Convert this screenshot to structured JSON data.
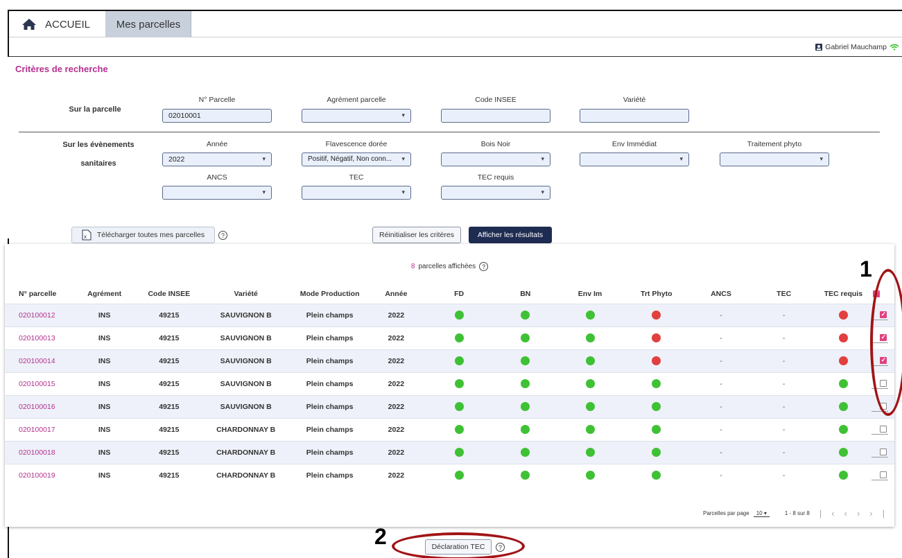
{
  "tabs": {
    "home_label": "ACCUEIL",
    "parcelles_label": "Mes parcelles"
  },
  "user": {
    "name": "Gabriel Mauchamp"
  },
  "criteria": {
    "title": "Critères de recherche",
    "parcel_row_label": "Sur la parcelle",
    "events_row_label_1": "Sur les évènements",
    "events_row_label_2": "sanitaires",
    "fields": {
      "num_parcelle": {
        "label": "N° Parcelle",
        "value": "02010001"
      },
      "agrement": {
        "label": "Agrément parcelle",
        "value": ""
      },
      "code_insee": {
        "label": "Code INSEE",
        "value": ""
      },
      "variete": {
        "label": "Variété",
        "value": ""
      },
      "annee": {
        "label": "Année",
        "value": "2022"
      },
      "flavescence": {
        "label": "Flavescence dorée",
        "value": "Positif, Négatif, Non conn..."
      },
      "bois_noir": {
        "label": "Bois Noir",
        "value": ""
      },
      "env_immediat": {
        "label": "Env Immédiat",
        "value": ""
      },
      "traitement": {
        "label": "Traitement phyto",
        "value": ""
      },
      "ancs": {
        "label": "ANCS",
        "value": ""
      },
      "tec": {
        "label": "TEC",
        "value": ""
      },
      "tec_requis": {
        "label": "TEC requis",
        "value": ""
      }
    },
    "download_label": "Télécharger toutes mes parcelles",
    "reset_label": "Réinitialiser les critères",
    "show_label": "Afficher les résultats"
  },
  "results": {
    "count": "8",
    "count_suffix": "parcelles affichées",
    "columns": [
      "N° parcelle",
      "Agrément",
      "Code INSEE",
      "Variété",
      "Mode Production",
      "Année",
      "FD",
      "BN",
      "Env Im",
      "Trt Phyto",
      "ANCS",
      "TEC",
      "TEC requis"
    ],
    "rows": [
      {
        "id": "020100012",
        "agrement": "INS",
        "insee": "49215",
        "variete": "SAUVIGNON B",
        "mode": "Plein champs",
        "annee": "2022",
        "fd": "green",
        "bn": "green",
        "env": "green",
        "trt": "red",
        "ancs": "-",
        "tec": "-",
        "tec_requis": "red",
        "checked": true
      },
      {
        "id": "020100013",
        "agrement": "INS",
        "insee": "49215",
        "variete": "SAUVIGNON B",
        "mode": "Plein champs",
        "annee": "2022",
        "fd": "green",
        "bn": "green",
        "env": "green",
        "trt": "red",
        "ancs": "-",
        "tec": "-",
        "tec_requis": "red",
        "checked": true
      },
      {
        "id": "020100014",
        "agrement": "INS",
        "insee": "49215",
        "variete": "SAUVIGNON B",
        "mode": "Plein champs",
        "annee": "2022",
        "fd": "green",
        "bn": "green",
        "env": "green",
        "trt": "red",
        "ancs": "-",
        "tec": "-",
        "tec_requis": "red",
        "checked": true
      },
      {
        "id": "020100015",
        "agrement": "INS",
        "insee": "49215",
        "variete": "SAUVIGNON B",
        "mode": "Plein champs",
        "annee": "2022",
        "fd": "green",
        "bn": "green",
        "env": "green",
        "trt": "green",
        "ancs": "-",
        "tec": "-",
        "tec_requis": "green",
        "checked": false
      },
      {
        "id": "020100016",
        "agrement": "INS",
        "insee": "49215",
        "variete": "SAUVIGNON B",
        "mode": "Plein champs",
        "annee": "2022",
        "fd": "green",
        "bn": "green",
        "env": "green",
        "trt": "green",
        "ancs": "-",
        "tec": "-",
        "tec_requis": "green",
        "checked": false
      },
      {
        "id": "020100017",
        "agrement": "INS",
        "insee": "49215",
        "variete": "CHARDONNAY B",
        "mode": "Plein champs",
        "annee": "2022",
        "fd": "green",
        "bn": "green",
        "env": "green",
        "trt": "green",
        "ancs": "-",
        "tec": "-",
        "tec_requis": "green",
        "checked": false
      },
      {
        "id": "020100018",
        "agrement": "INS",
        "insee": "49215",
        "variete": "CHARDONNAY B",
        "mode": "Plein champs",
        "annee": "2022",
        "fd": "green",
        "bn": "green",
        "env": "green",
        "trt": "green",
        "ancs": "-",
        "tec": "-",
        "tec_requis": "green",
        "checked": false
      },
      {
        "id": "020100019",
        "agrement": "INS",
        "insee": "49215",
        "variete": "CHARDONNAY B",
        "mode": "Plein champs",
        "annee": "2022",
        "fd": "green",
        "bn": "green",
        "env": "green",
        "trt": "green",
        "ancs": "-",
        "tec": "-",
        "tec_requis": "green",
        "checked": false
      }
    ],
    "header_checked": true,
    "pager": {
      "label": "Parcelles par page",
      "per_page": "10",
      "range": "1 - 8 sur 8"
    }
  },
  "declaration_label": "Déclaration TEC",
  "annotations": {
    "one": "1",
    "two": "2"
  },
  "colors": {
    "accent": "#b5308f",
    "primary": "#1f2c52",
    "ok": "#3fc135",
    "ko": "#e23f3f",
    "annotation": "#a11417"
  }
}
